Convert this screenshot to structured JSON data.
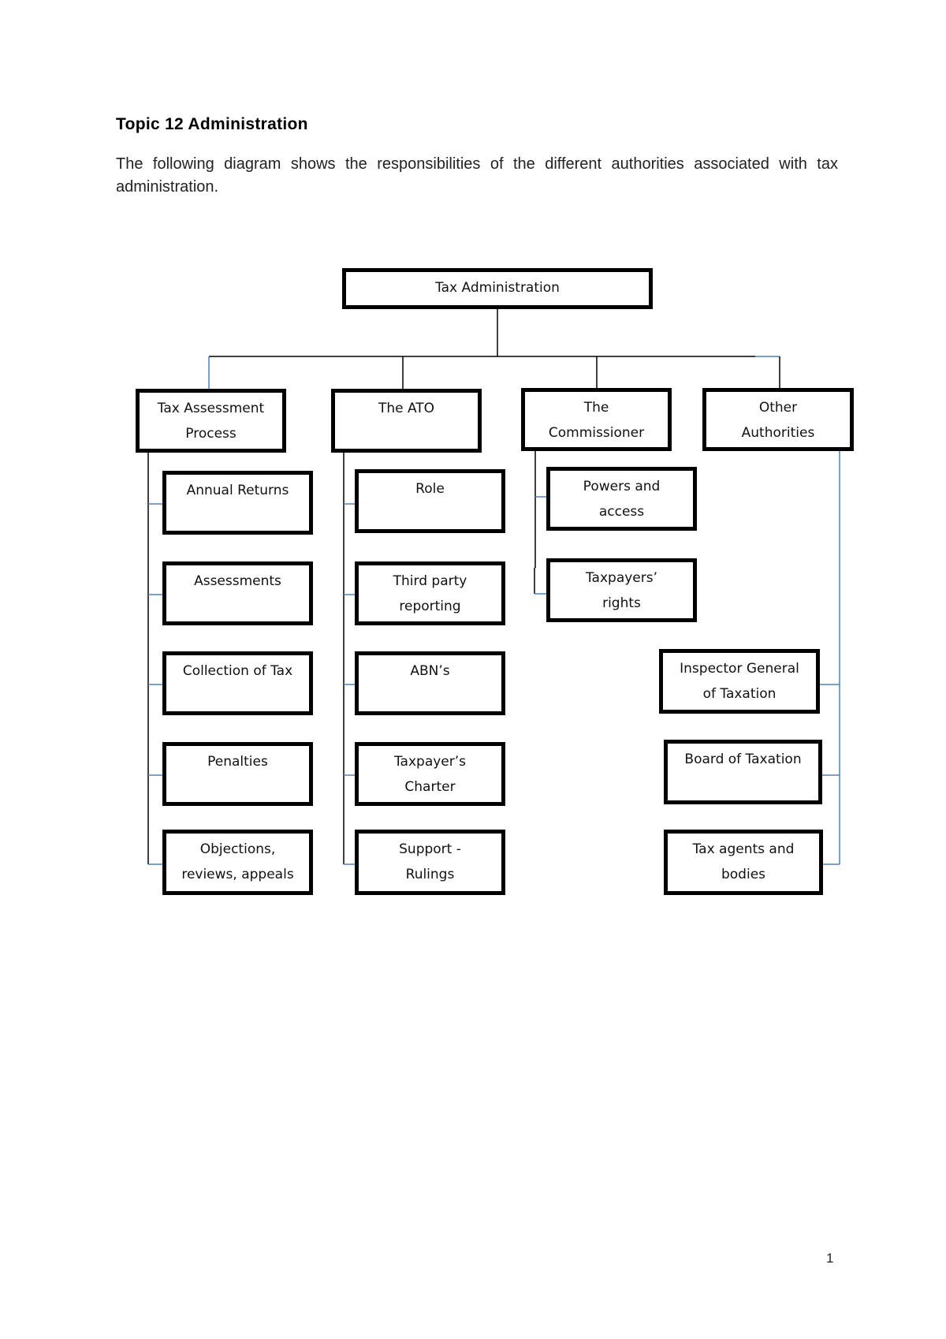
{
  "heading": "Topic 12 Administration",
  "intro": "The following diagram shows the responsibilities of the different authorities associated with tax administration.",
  "page_number": "1",
  "colors": {
    "box_border": "#000000",
    "connector": "#000000",
    "connector_accent": "#4f81bd"
  },
  "diagram": {
    "root": "Tax Administration",
    "branches": [
      {
        "label": "Tax Assessment\nProcess",
        "children": [
          "Annual Returns",
          "Assessments",
          "Collection of Tax",
          "Penalties",
          "Objections,\nreviews, appeals"
        ]
      },
      {
        "label": "The ATO",
        "children": [
          "Role",
          "Third party\nreporting",
          "ABN’s",
          "Taxpayer’s\nCharter",
          "Support -\nRulings"
        ]
      },
      {
        "label": "The\nCommissioner",
        "children": [
          "Powers and\naccess",
          "Taxpayers’\nrights"
        ]
      },
      {
        "label": "Other\nAuthorities",
        "children": [
          "Inspector General\nof Taxation",
          "Board of Taxation",
          "Tax agents and\nbodies"
        ]
      }
    ]
  }
}
